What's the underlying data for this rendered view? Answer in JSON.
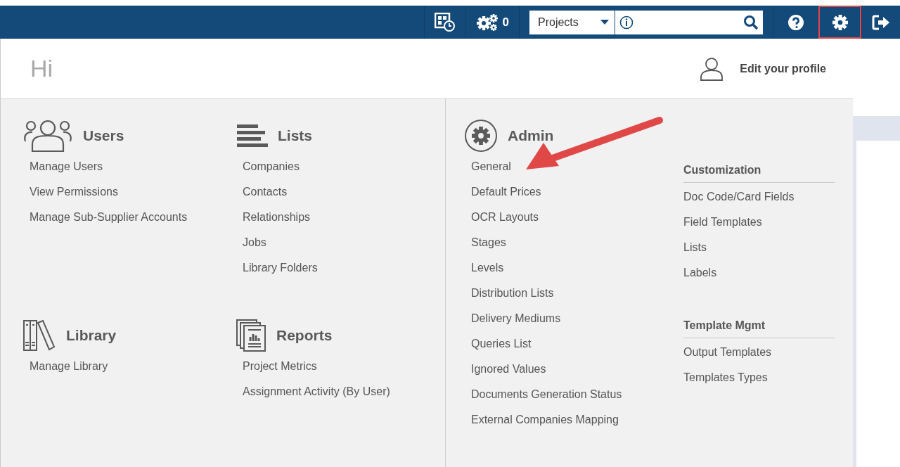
{
  "top_bar": {
    "jobs_count": "0",
    "search": {
      "scope": "Projects"
    },
    "settings_highlighted": true
  },
  "greeting": "Hi",
  "profile_link": "Edit your profile",
  "left_sections": [
    {
      "kind": "users",
      "title": "Users",
      "items": [
        "Manage Users",
        "View Permissions",
        "Manage Sub-Supplier Accounts"
      ]
    },
    {
      "kind": "lists",
      "title": "Lists",
      "items": [
        "Companies",
        "Contacts",
        "Relationships",
        "Jobs",
        "Library Folders"
      ]
    },
    {
      "kind": "library",
      "title": "Library",
      "items": [
        "Manage Library"
      ]
    },
    {
      "kind": "reports",
      "title": "Reports",
      "items": [
        "Project Metrics",
        "Assignment Activity (By User)"
      ]
    }
  ],
  "admin": {
    "kind": "admin",
    "title": "Admin",
    "items": [
      "General",
      "Default Prices",
      "OCR Layouts",
      "Stages",
      "Levels",
      "Distribution Lists",
      "Delivery Mediums",
      "Queries List",
      "Ignored Values",
      "Documents Generation Status",
      "External Companies Mapping"
    ]
  },
  "admin_groups": [
    {
      "title": "Customization",
      "items": [
        "Doc Code/Card Fields",
        "Field Templates",
        "Lists",
        "Labels"
      ]
    },
    {
      "title": "Template Mgmt",
      "items": [
        "Output Templates",
        "Templates Types"
      ]
    }
  ]
}
